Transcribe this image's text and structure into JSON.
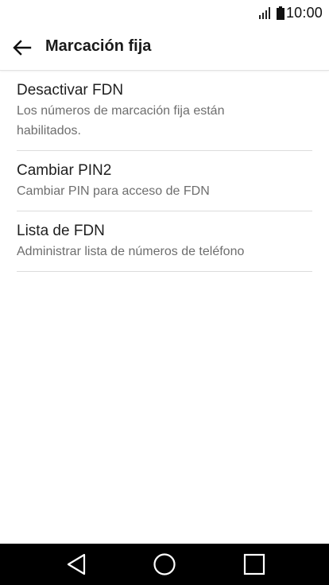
{
  "status_bar": {
    "time": "10:00",
    "icons": [
      "signal-icon",
      "battery-icon"
    ]
  },
  "app_bar": {
    "title": "Marcación fija",
    "back_icon": "arrow-left-icon"
  },
  "list": {
    "items": [
      {
        "title": "Desactivar FDN",
        "summary": "Los números de marcación fija están habilitados."
      },
      {
        "title": "Cambiar PIN2",
        "summary": "Cambiar PIN para acceso de FDN"
      },
      {
        "title": "Lista de FDN",
        "summary": "Administrar lista de números de teléfono"
      }
    ]
  },
  "nav_bar": {
    "icons": [
      "back-triangle-icon",
      "home-circle-icon",
      "recents-square-icon"
    ]
  },
  "colors": {
    "background": "#ffffff",
    "title_text": "#1f1f1f",
    "summary_text": "#6e6e6e",
    "divider": "#dcdcdc",
    "nav_bar": "#000000"
  }
}
